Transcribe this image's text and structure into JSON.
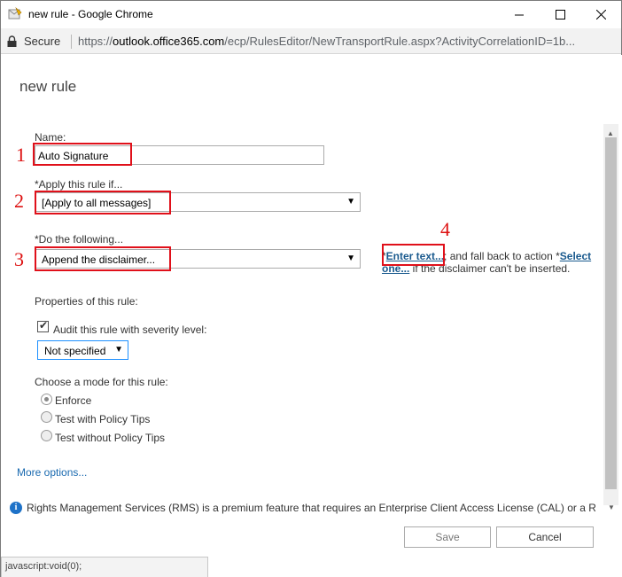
{
  "browser": {
    "window_title": "new rule - Google Chrome",
    "secure_label": "Secure",
    "url_scheme": "https://",
    "url_host": "outlook.office365.com",
    "url_path": "/ecp/RulesEditor/NewTransportRule.aspx?ActivityCorrelationID=1b..."
  },
  "page": {
    "title": "new rule"
  },
  "form": {
    "name_label": "Name:",
    "name_value": "Auto Signature",
    "apply_label": "*Apply this rule if...",
    "apply_value": "[Apply to all messages]",
    "do_label": "*Do the following...",
    "do_value": "Append the disclaimer...",
    "action_prefix": "*",
    "enter_text_link": "Enter text...",
    "action_middle": "; and fall back to action *",
    "select_link_1": "Select",
    "select_link_2": "one...",
    "action_suffix": " if the disclaimer can't be inserted.",
    "properties_label": "Properties of this rule:",
    "audit_label": "Audit this rule with severity level:",
    "severity_value": "Not specified",
    "mode_label": "Choose a mode for this rule:",
    "modes": [
      {
        "label": "Enforce",
        "selected": true
      },
      {
        "label": "Test with Policy Tips",
        "selected": false
      },
      {
        "label": "Test without Policy Tips",
        "selected": false
      }
    ],
    "more_options": "More options..."
  },
  "annotations": [
    "1",
    "2",
    "3",
    "4"
  ],
  "annotation_color": "#e0101a",
  "rms_notice": "Rights Management Services (RMS) is a premium feature that requires an Enterprise Client Access License (CAL) or a RMS",
  "buttons": {
    "save": "Save",
    "cancel": "Cancel"
  },
  "status_bar": "javascript:void(0);"
}
